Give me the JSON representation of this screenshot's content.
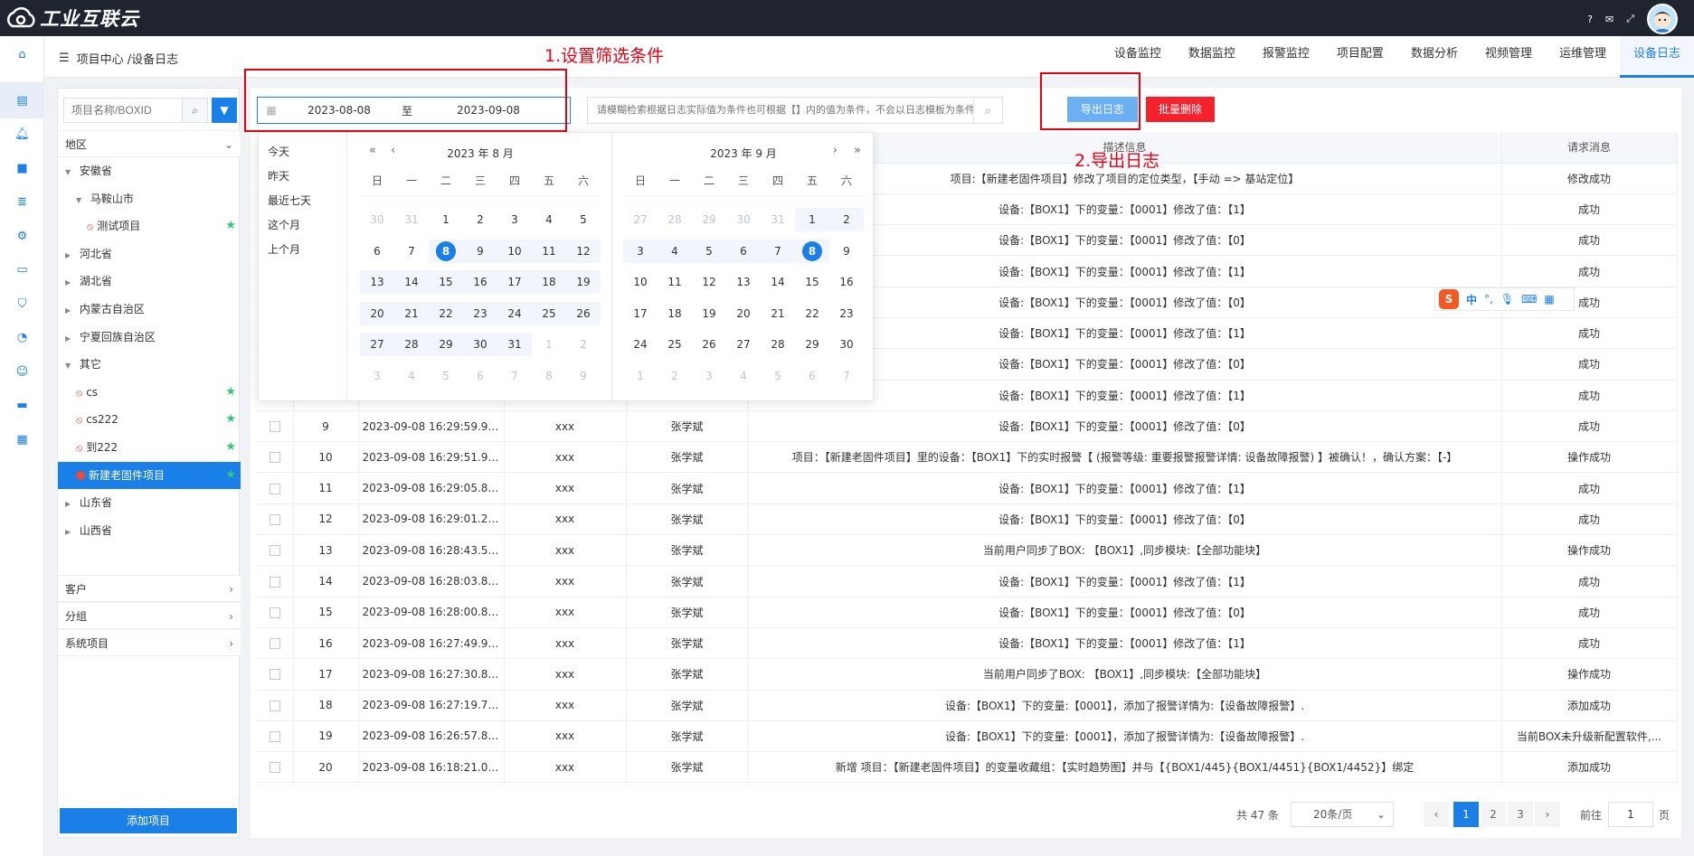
{
  "topbar": {
    "logo_text": "工业互联云",
    "icons": [
      "help-icon",
      "mail-icon",
      "fullscreen-icon"
    ]
  },
  "subheader": {
    "breadcrumb": "项目中心 /设备日志",
    "nav": [
      "设备监控",
      "数据监控",
      "报警监控",
      "项目配置",
      "数据分析",
      "视频管理",
      "运维管理",
      "设备日志"
    ],
    "active_nav": "设备日志"
  },
  "sidebar": {
    "search_placeholder": "项目名称/BOXID",
    "region_label": "地区",
    "tree": [
      {
        "label": "安徽省",
        "level": 0,
        "expanded": true
      },
      {
        "label": "马鞍山市",
        "level": 1,
        "expanded": true
      },
      {
        "label": "测试项目",
        "level": 2,
        "leaf": true,
        "star": true
      },
      {
        "label": "河北省",
        "level": 0
      },
      {
        "label": "湖北省",
        "level": 0
      },
      {
        "label": "内蒙古自治区",
        "level": 0
      },
      {
        "label": "宁夏回族自治区",
        "level": 0
      },
      {
        "label": "其它",
        "level": 0,
        "expanded": true
      },
      {
        "label": "cs",
        "level": 1,
        "leaf": true,
        "star": true
      },
      {
        "label": "cs222",
        "level": 1,
        "leaf": true,
        "star": true
      },
      {
        "label": "到222",
        "level": 1,
        "leaf": true,
        "star": true
      },
      {
        "label": "新建老固件项目",
        "level": 1,
        "leaf": true,
        "star": true,
        "selected": true
      },
      {
        "label": "山东省",
        "level": 0
      },
      {
        "label": "山西省",
        "level": 0
      }
    ],
    "sections": [
      "客户",
      "分组",
      "系统项目"
    ],
    "add_button": "添加项目"
  },
  "toolbar": {
    "date_start": "2023-08-08",
    "date_sep": "至",
    "date_end": "2023-09-08",
    "keyword_placeholder": "请模糊检索根据日志实际值为条件也可根据【】内的值为条件，不会以日志模板为条件",
    "export_label": "导出日志",
    "batch_delete_label": "批量删除"
  },
  "annotations": {
    "step1": "1.设置筛选条件",
    "step2": "2.导出日志"
  },
  "table": {
    "headers": [
      "",
      "",
      "",
      "",
      "",
      "描述信息",
      "请求消息"
    ],
    "rows": [
      {
        "no": "",
        "time": "",
        "user": "",
        "name": "",
        "desc": "项目:【新建老固件项目】修改了项目的定位类型，【手动 => 基站定位】",
        "result": "修改成功"
      },
      {
        "no": "",
        "time": "",
        "user": "",
        "name": "",
        "desc": "设备:【BOX1】下的变量：【0001】修改了值：【1】",
        "result": "成功"
      },
      {
        "no": "",
        "time": "",
        "user": "",
        "name": "",
        "desc": "设备:【BOX1】下的变量：【0001】修改了值：【0】",
        "result": "成功"
      },
      {
        "no": "",
        "time": "",
        "user": "",
        "name": "",
        "desc": "设备:【BOX1】下的变量：【0001】修改了值：【1】",
        "result": "成功"
      },
      {
        "no": "",
        "time": "",
        "user": "",
        "name": "",
        "desc": "设备:【BOX1】下的变量：【0001】修改了值：【0】",
        "result": "成功"
      },
      {
        "no": "",
        "time": "",
        "user": "",
        "name": "",
        "desc": "设备:【BOX1】下的变量：【0001】修改了值：【1】",
        "result": "成功"
      },
      {
        "no": "",
        "time": "",
        "user": "",
        "name": "",
        "desc": "设备:【BOX1】下的变量：【0001】修改了值：【0】",
        "result": "成功"
      },
      {
        "no": "",
        "time": "",
        "user": "",
        "name": "",
        "desc": "设备:【BOX1】下的变量：【0001】修改了值：【1】",
        "result": "成功"
      },
      {
        "no": "9",
        "time": "2023-09-08 16:29:59.940",
        "user": "xxx",
        "name": "张学斌",
        "desc": "设备:【BOX1】下的变量：【0001】修改了值：【0】",
        "result": "成功"
      },
      {
        "no": "10",
        "time": "2023-09-08 16:29:51.952",
        "user": "xxx",
        "name": "张学斌",
        "desc": "项目：【新建老固件项目】里的设备：【BOX1】下的实时报警【 (报警等级: 重要报警报警详情: 设备故障报警) 】被确认！，确认方案：【-】",
        "result": "操作成功"
      },
      {
        "no": "11",
        "time": "2023-09-08 16:29:05.891",
        "user": "xxx",
        "name": "张学斌",
        "desc": "设备:【BOX1】下的变量：【0001】修改了值：【1】",
        "result": "成功"
      },
      {
        "no": "12",
        "time": "2023-09-08 16:29:01.276",
        "user": "xxx",
        "name": "张学斌",
        "desc": "设备:【BOX1】下的变量：【0001】修改了值：【0】",
        "result": "成功"
      },
      {
        "no": "13",
        "time": "2023-09-08 16:28:43.589",
        "user": "xxx",
        "name": "张学斌",
        "desc": "当前用户同步了BOX: 【BOX1】,同步模块:【全部功能块】",
        "result": "操作成功"
      },
      {
        "no": "14",
        "time": "2023-09-08 16:28:03.864",
        "user": "xxx",
        "name": "张学斌",
        "desc": "设备:【BOX1】下的变量：【0001】修改了值：【1】",
        "result": "成功"
      },
      {
        "no": "15",
        "time": "2023-09-08 16:28:00.898",
        "user": "xxx",
        "name": "张学斌",
        "desc": "设备:【BOX1】下的变量：【0001】修改了值：【0】",
        "result": "成功"
      },
      {
        "no": "16",
        "time": "2023-09-08 16:27:49.927",
        "user": "xxx",
        "name": "张学斌",
        "desc": "设备:【BOX1】下的变量：【0001】修改了值：【1】",
        "result": "成功"
      },
      {
        "no": "17",
        "time": "2023-09-08 16:27:30.826",
        "user": "xxx",
        "name": "张学斌",
        "desc": "当前用户同步了BOX: 【BOX1】,同步模块:【全部功能块】",
        "result": "操作成功"
      },
      {
        "no": "18",
        "time": "2023-09-08 16:27:19.758",
        "user": "xxx",
        "name": "张学斌",
        "desc": "设备:【BOX1】下的变量:【0001】，添加了报警详情为:【设备故障报警】.",
        "result": "添加成功"
      },
      {
        "no": "19",
        "time": "2023-09-08 16:26:57.855",
        "user": "xxx",
        "name": "张学斌",
        "desc": "设备:【BOX1】下的变量:【0001】，添加了报警详情为:【设备故障报警】.",
        "result": "当前BOX未升级新配置软件,..."
      },
      {
        "no": "20",
        "time": "2023-09-08 16:18:21.057",
        "user": "xxx",
        "name": "张学斌",
        "desc": "新增 项目：【新建老固件项目】的变量收藏组：【实时趋势图】并与【{BOX1/445}{BOX1/4451}{BOX1/4452}】绑定",
        "result": "添加成功"
      }
    ]
  },
  "pagination": {
    "total": "共 47 条",
    "page_size": "20条/页",
    "pages": [
      "1",
      "2",
      "3"
    ],
    "current": "1",
    "goto_label": "前往",
    "goto_value": "1",
    "page_suffix": "页"
  },
  "datepicker": {
    "shortcuts": [
      "今天",
      "昨天",
      "最近七天",
      "这个月",
      "上个月"
    ],
    "weekdays": [
      "日",
      "一",
      "二",
      "三",
      "四",
      "五",
      "六"
    ],
    "left": {
      "title": "2023 年 8 月",
      "days": [
        [
          "30",
          "31",
          "1",
          "2",
          "3",
          "4",
          "5"
        ],
        [
          "6",
          "7",
          "8",
          "9",
          "10",
          "11",
          "12"
        ],
        [
          "13",
          "14",
          "15",
          "16",
          "17",
          "18",
          "19"
        ],
        [
          "20",
          "21",
          "22",
          "23",
          "24",
          "25",
          "26"
        ],
        [
          "27",
          "28",
          "29",
          "30",
          "31",
          "1",
          "2"
        ],
        [
          "3",
          "4",
          "5",
          "6",
          "7",
          "8",
          "9"
        ]
      ]
    },
    "right": {
      "title": "2023 年 9 月",
      "days": [
        [
          "27",
          "28",
          "29",
          "30",
          "31",
          "1",
          "2"
        ],
        [
          "3",
          "4",
          "5",
          "6",
          "7",
          "8",
          "9"
        ],
        [
          "10",
          "11",
          "12",
          "13",
          "14",
          "15",
          "16"
        ],
        [
          "17",
          "18",
          "19",
          "20",
          "21",
          "22",
          "23"
        ],
        [
          "24",
          "25",
          "26",
          "27",
          "28",
          "29",
          "30"
        ],
        [
          "1",
          "2",
          "3",
          "4",
          "5",
          "6",
          "7"
        ]
      ]
    }
  },
  "ime": {
    "label": "中"
  },
  "colors": {
    "primary": "#1a7fe6",
    "danger": "#f5222d",
    "annotation": "#e60012",
    "topbar": "#20242f"
  }
}
